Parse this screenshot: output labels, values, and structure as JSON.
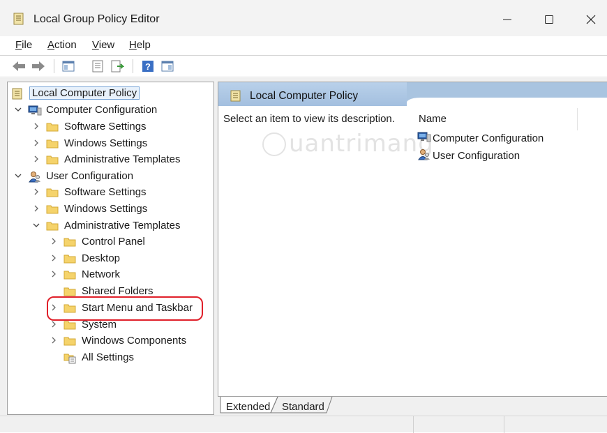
{
  "window": {
    "title": "Local Group Policy Editor",
    "controls": [
      "minimize-icon",
      "maximize-icon",
      "close-icon"
    ]
  },
  "menu": {
    "items": [
      {
        "label_u": "F",
        "label_rest": "ile"
      },
      {
        "label_u": "A",
        "label_rest": "ction"
      },
      {
        "label_u": "V",
        "label_rest": "iew"
      },
      {
        "label_u": "H",
        "label_rest": "elp"
      }
    ]
  },
  "toolbar": {
    "icons": [
      "back-icon",
      "forward-icon",
      "show-hide-console-tree-icon",
      "properties-icon",
      "export-list-icon",
      "help-icon",
      "show-action-pane-icon"
    ]
  },
  "tree": {
    "root": "Local Computer Policy",
    "computer_configuration": "Computer Configuration",
    "cc_software": "Software Settings",
    "cc_windows": "Windows Settings",
    "cc_admin": "Administrative Templates",
    "user_configuration": "User Configuration",
    "uc_software": "Software Settings",
    "uc_windows": "Windows Settings",
    "uc_admin": "Administrative Templates",
    "control_panel": "Control Panel",
    "desktop": "Desktop",
    "network": "Network",
    "shared_folders": "Shared Folders",
    "start_menu": "Start Menu and Taskbar",
    "system": "System",
    "windows_components": "Windows Components",
    "all_settings": "All Settings"
  },
  "details": {
    "header_title": "Local Computer Policy",
    "description": "Select an item to view its description.",
    "column_name": "Name",
    "items": [
      "Computer Configuration",
      "User Configuration"
    ]
  },
  "watermark": "uantrimang",
  "tabs": {
    "extended": "Extended",
    "standard": "Standard"
  },
  "colors": {
    "highlight_ring": "#e0202a",
    "header_blue": "#a9c4e0",
    "folder_yellow": "#f5d36b"
  }
}
